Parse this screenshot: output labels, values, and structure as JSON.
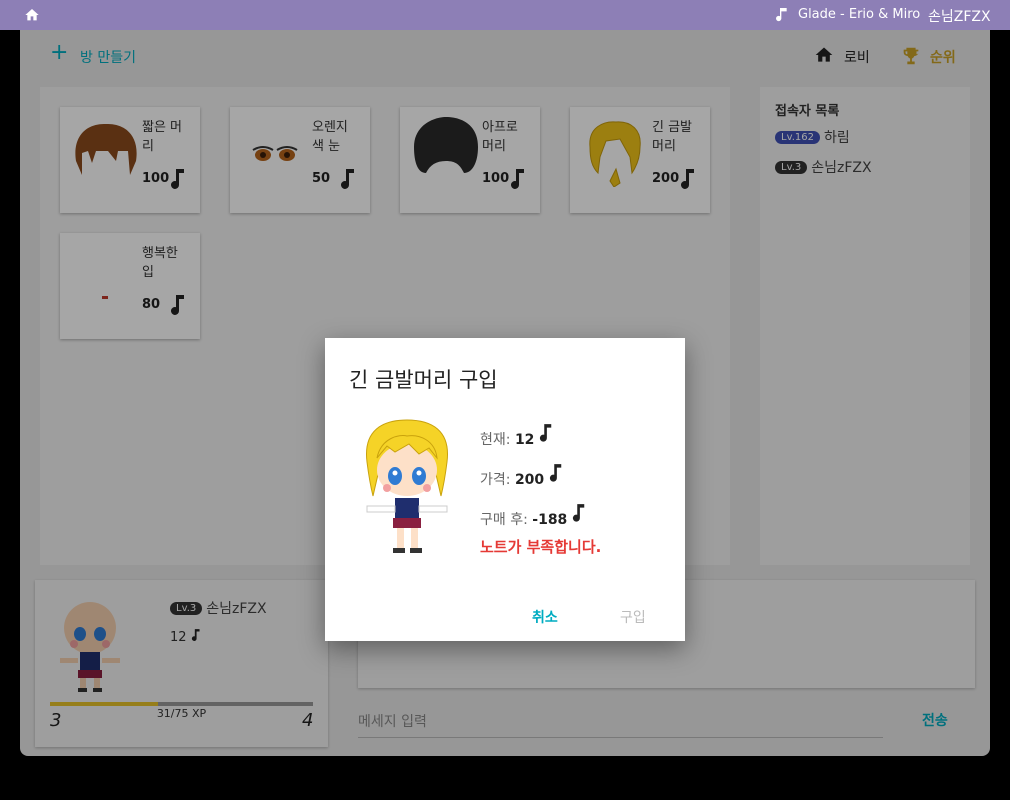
{
  "topbar": {
    "song": "Glade - Erio & Miro",
    "user": "손님ZFZX"
  },
  "header": {
    "make_room": "방 만들기",
    "lobby": "로비",
    "ranking": "순위"
  },
  "shop": {
    "items": [
      {
        "name": "짧은 머리",
        "price": "100"
      },
      {
        "name": "오렌지 색 눈",
        "price": "50"
      },
      {
        "name": "아프로 머리",
        "price": "100"
      },
      {
        "name": "긴 금발 머리",
        "price": "200"
      },
      {
        "name": "행복한 입",
        "price": "80"
      }
    ]
  },
  "users": {
    "title": "접속자 목록",
    "list": [
      {
        "level": "Lv.162",
        "name": "하림"
      },
      {
        "level": "Lv.3",
        "name": "손님zFZX"
      }
    ]
  },
  "profile": {
    "level": "Lv.3",
    "name": "손님zFZX",
    "notes": "12",
    "xp_text": "31/75 XP",
    "xp_fraction": 0.41,
    "level_current": "3",
    "level_next": "4"
  },
  "chat": {
    "placeholder": "메세지 입력",
    "send": "전송"
  },
  "dialog": {
    "title": "긴 금발머리 구입",
    "current_label": "현재:",
    "current_value": "12",
    "price_label": "가격:",
    "price_value": "200",
    "after_label": "구매 후:",
    "after_value": "-188",
    "warning": "노트가 부족합니다.",
    "cancel": "취소",
    "buy": "구입"
  },
  "colors": {
    "accent": "#00acc1",
    "topbar": "#8d7fb6",
    "warning": "#e53935",
    "gold": "#c9a227"
  }
}
